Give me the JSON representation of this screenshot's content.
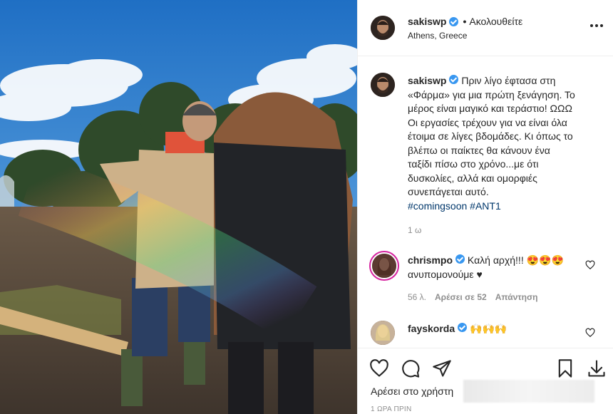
{
  "post": {
    "username": "sakiswp",
    "follow_status": "Ακολουθείτε",
    "separator": "•",
    "location": "Athens, Greece",
    "more_label": "•••",
    "caption_lines": [
      "Πριν λίγο έφτασα στη",
      "«Φάρμα» για μια πρώτη ξενάγηση. Το",
      "μέρος είναι μαγικό και τεράστιο! ",
      "Οι εργασίες τρέχουν για να είναι όλα",
      "έτοιμα σε λίγες βδομάδες. Κι όπως το",
      "βλέπω οι παίκτες θα κάνουν ένα",
      "ταξίδι πίσω στο χρόνο...με ότι",
      "δυσκολίες, αλλά και ομορφιές",
      "συνεπάγεται αυτό."
    ],
    "caption_emoji": "ΩΩΩ",
    "hashtags": "#comingsoon #ANT1",
    "caption_time": "1 ω"
  },
  "comments": [
    {
      "username": "chrismpo",
      "text_line1": "Καλή αρχή!!! 😍😍😍",
      "text_line2": "ανυπομονούμε ♥",
      "age": "56 λ.",
      "likes": "Αρέσει σε 52",
      "reply": "Απάντηση"
    },
    {
      "username": "fayskorda",
      "text": "🙌🙌🙌"
    }
  ],
  "actions": {
    "like_icon": "heart-icon",
    "comment_icon": "comment-bubble-icon",
    "share_icon": "paper-plane-icon",
    "save_icon": "bookmark-icon",
    "download_icon": "download-icon",
    "liked_by": "Αρέσει στο χρήστη",
    "post_time": "1 ΩΡΑ ΠΡΙΝ"
  },
  "colors": {
    "accent": "#3897f0",
    "hashtag": "#00376b",
    "muted": "#8e8e8e"
  }
}
